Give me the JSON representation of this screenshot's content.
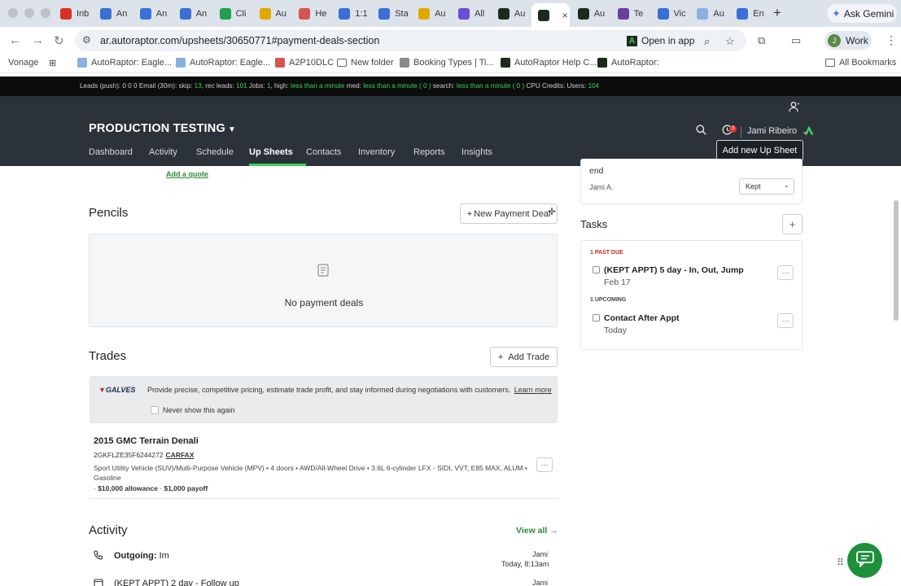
{
  "browser": {
    "tabs": [
      {
        "label": "Inb",
        "color": "#d93025"
      },
      {
        "label": "An",
        "color": "#3b6fd6"
      },
      {
        "label": "An",
        "color": "#3b6fd6"
      },
      {
        "label": "An",
        "color": "#3b6fd6"
      },
      {
        "label": "Cli",
        "color": "#22a04b"
      },
      {
        "label": "Au",
        "color": "#e0a800"
      },
      {
        "label": "He",
        "color": "#d9534f"
      },
      {
        "label": "1:1",
        "color": "#3b6fd6"
      },
      {
        "label": "Sta",
        "color": "#3b6fd6"
      },
      {
        "label": "Au",
        "color": "#e0a800"
      },
      {
        "label": "All",
        "color": "#6b4fd6"
      },
      {
        "label": "Au",
        "color": "#1f2a1f"
      },
      {
        "label": "",
        "color": "#1f2a1f",
        "active": true
      },
      {
        "label": "Au",
        "color": "#1f2a1f"
      },
      {
        "label": "Te",
        "color": "#6b3fa0"
      },
      {
        "label": "Vic",
        "color": "#3b6fd6"
      },
      {
        "label": "Au",
        "color": "#8ab0e0"
      },
      {
        "label": "En",
        "color": "#3b6fd6"
      }
    ],
    "new_tab": "+",
    "gemini_label": "Ask Gemini",
    "url": "ar.autoraptor.com/upsheets/30650771#payment-deals-section",
    "open_in_app": "Open in app",
    "profile_label": "Work",
    "profile_initial": "J",
    "bookmarks": [
      {
        "label": "Vonage"
      },
      {
        "label": "AutoRaptor: Eagle..."
      },
      {
        "label": "AutoRaptor: Eagle..."
      },
      {
        "label": "A2P10DLC"
      },
      {
        "label": "New folder"
      },
      {
        "label": "Booking Types | Ti..."
      },
      {
        "label": "AutoRaptor Help C..."
      },
      {
        "label": "AutoRaptor:"
      }
    ],
    "all_bookmarks": "All Bookmarks"
  },
  "debug": {
    "part1": "Leads (push): 0 0 0 Email (30m): skip: ",
    "skip": "13",
    "part2": ", rec leads: ",
    "rec": "101",
    "part3": " Jobs: ",
    "jobs": "1",
    "part4": ", high: ",
    "high": "less than a minute",
    "part5": " med: ",
    "med": "less than a minute ( 0 )",
    "part6": " search: ",
    "search": "less than a minute ( 0 )",
    "part7": " CPU Credits: Users: ",
    "users": "104"
  },
  "header": {
    "brand": "PRODUCTION TESTING",
    "user": "Jami Ribeiro",
    "notif_count": "3",
    "tooltip": "Add new Up Sheet",
    "nav": [
      {
        "label": "Dashboard"
      },
      {
        "label": "Activity"
      },
      {
        "label": "Schedule"
      },
      {
        "label": "Up Sheets",
        "active": true
      },
      {
        "label": "Contacts"
      },
      {
        "label": "Inventory"
      },
      {
        "label": "Reports"
      },
      {
        "label": "Insights"
      }
    ]
  },
  "main": {
    "add_quote": "Add a quote",
    "pencils": {
      "title": "Pencils",
      "new_button": "New Payment Deal",
      "empty": "No payment deals"
    },
    "trades": {
      "title": "Trades",
      "add_button": "Add Trade",
      "galves_text": "Provide precise, competitive pricing, estimate trade profit, and stay informed during negotiations with customers.",
      "learn_more": "Learn more",
      "never_show": "Never show this again",
      "vehicle": {
        "title": "2015 GMC Terrain Denali",
        "vin": "2GKFLZE35F6244272",
        "carfax": "CARFAX",
        "description": "Sport Utility Vehicle (SUV)/Multi-Purpose Vehicle (MPV) • 4 doors • AWD/All-Wheel Drive • 3.6L 6-cylinder LFX - SIDI, VVT, E85 MAX, ALUM • Gasoline",
        "allowance": "$10,000 allowance",
        "payoff": "$1,000 payoff"
      }
    },
    "activity": {
      "title": "Activity",
      "view_all": "View all",
      "rows": [
        {
          "type_label": "Outgoing:",
          "text": "Im",
          "user": "Jami",
          "time": "Today, 8:13am"
        },
        {
          "text": "(KEPT APPT) 2 day - Follow up",
          "user": "Jami"
        }
      ]
    }
  },
  "right": {
    "appt": {
      "end_text": "end",
      "user": "Jami A.",
      "status": "Kept"
    },
    "tasks": {
      "title": "Tasks",
      "add": "+",
      "past_due_label": "1 PAST DUE",
      "upcoming_label": "1 UPCOMING",
      "items": [
        {
          "title": "(KEPT APPT) 5 day - In, Out, Jump",
          "date": "Feb 17"
        },
        {
          "title": "Contact After Appt",
          "date": "Today"
        }
      ]
    }
  },
  "colors": {
    "accent": "#3bd15b",
    "link": "#2e8b3c",
    "past_due": "#c62828",
    "header_bg": "#2b3239"
  }
}
